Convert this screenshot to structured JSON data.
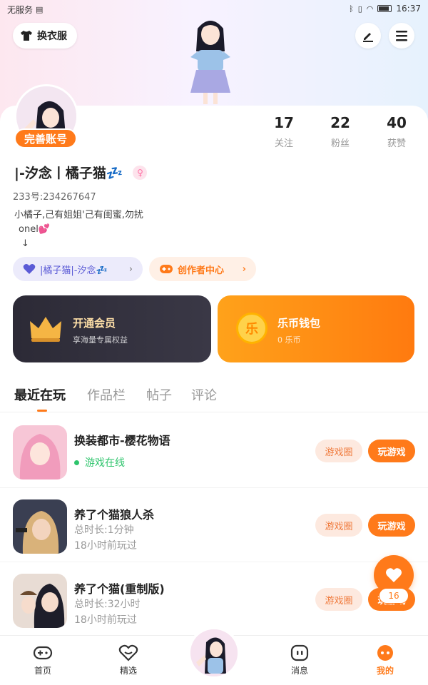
{
  "status_bar": {
    "carrier": "无服务",
    "time": "16:37"
  },
  "header": {
    "wardrobe_label": "换衣服",
    "edit_icon": "pencil-icon",
    "menu_icon": "hamburger-icon"
  },
  "profile": {
    "badge": "完善账号",
    "name": "|-汐念丨橘子猫💤",
    "uid": "233号:234267647",
    "bio_line1": "小橘子,己有姐姐'己有闺蜜,勿扰",
    "bio_line2": "onel💕",
    "bio_line3": "↓"
  },
  "stats": [
    {
      "value": "17",
      "label": "关注"
    },
    {
      "value": "22",
      "label": "粉丝"
    },
    {
      "value": "40",
      "label": "获赞"
    }
  ],
  "pills": {
    "fan": "|橘子猫|-汐念💤",
    "creator": "创作者中心"
  },
  "promos": {
    "vip_title": "开通会员",
    "vip_sub": "享海量专属权益",
    "wallet_title": "乐币钱包",
    "wallet_sub": "0 乐币",
    "coin_char": "乐"
  },
  "tabs": [
    "最近在玩",
    "作品栏",
    "帖子",
    "评论"
  ],
  "games": [
    {
      "title": "换装都市-樱花物语",
      "line1": "游戏在线",
      "line2": "",
      "circle": "游戏圈",
      "play": "玩游戏"
    },
    {
      "title": "养了个猫狼人杀",
      "line1": "总时长:1分钟",
      "line2": "18小时前玩过",
      "circle": "游戏圈",
      "play": "玩游戏"
    },
    {
      "title": "养了个猫(重制版)",
      "line1": "总时长:32小时",
      "line2": "18小时前玩过",
      "circle": "游戏圈",
      "play": "玩游戏"
    }
  ],
  "fab": {
    "count": "16"
  },
  "nav": [
    "首页",
    "精选",
    "消息",
    "我的"
  ],
  "colors": {
    "accent": "#ff7a1a",
    "online": "#2ec46c"
  }
}
